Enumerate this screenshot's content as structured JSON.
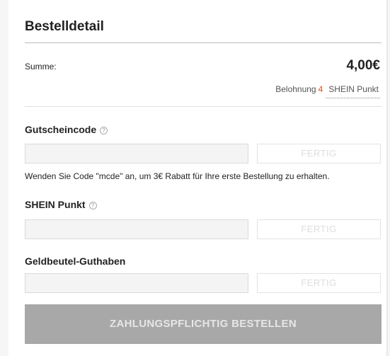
{
  "order": {
    "title": "Bestelldetail",
    "sum_label": "Summe:",
    "sum_value": "4,00€",
    "reward_label": "Belohnung",
    "reward_points": "4",
    "reward_unit": "SHEIN Punkt"
  },
  "coupon": {
    "title": "Gutscheincode",
    "help_icon": "?",
    "input_value": "",
    "button": "FERTIG",
    "hint": "Wenden Sie Code \"mcde\" an, um 3€ Rabatt für Ihre erste Bestellung zu erhalten."
  },
  "points": {
    "title": "SHEIN Punkt",
    "help_icon": "?",
    "input_value": "",
    "button": "FERTIG"
  },
  "wallet": {
    "title": "Geldbeutel-Guthaben",
    "input_value": "",
    "button": "FERTIG"
  },
  "checkout": {
    "button": "ZAHLUNGSPFLICHTIG BESTELLEN"
  }
}
